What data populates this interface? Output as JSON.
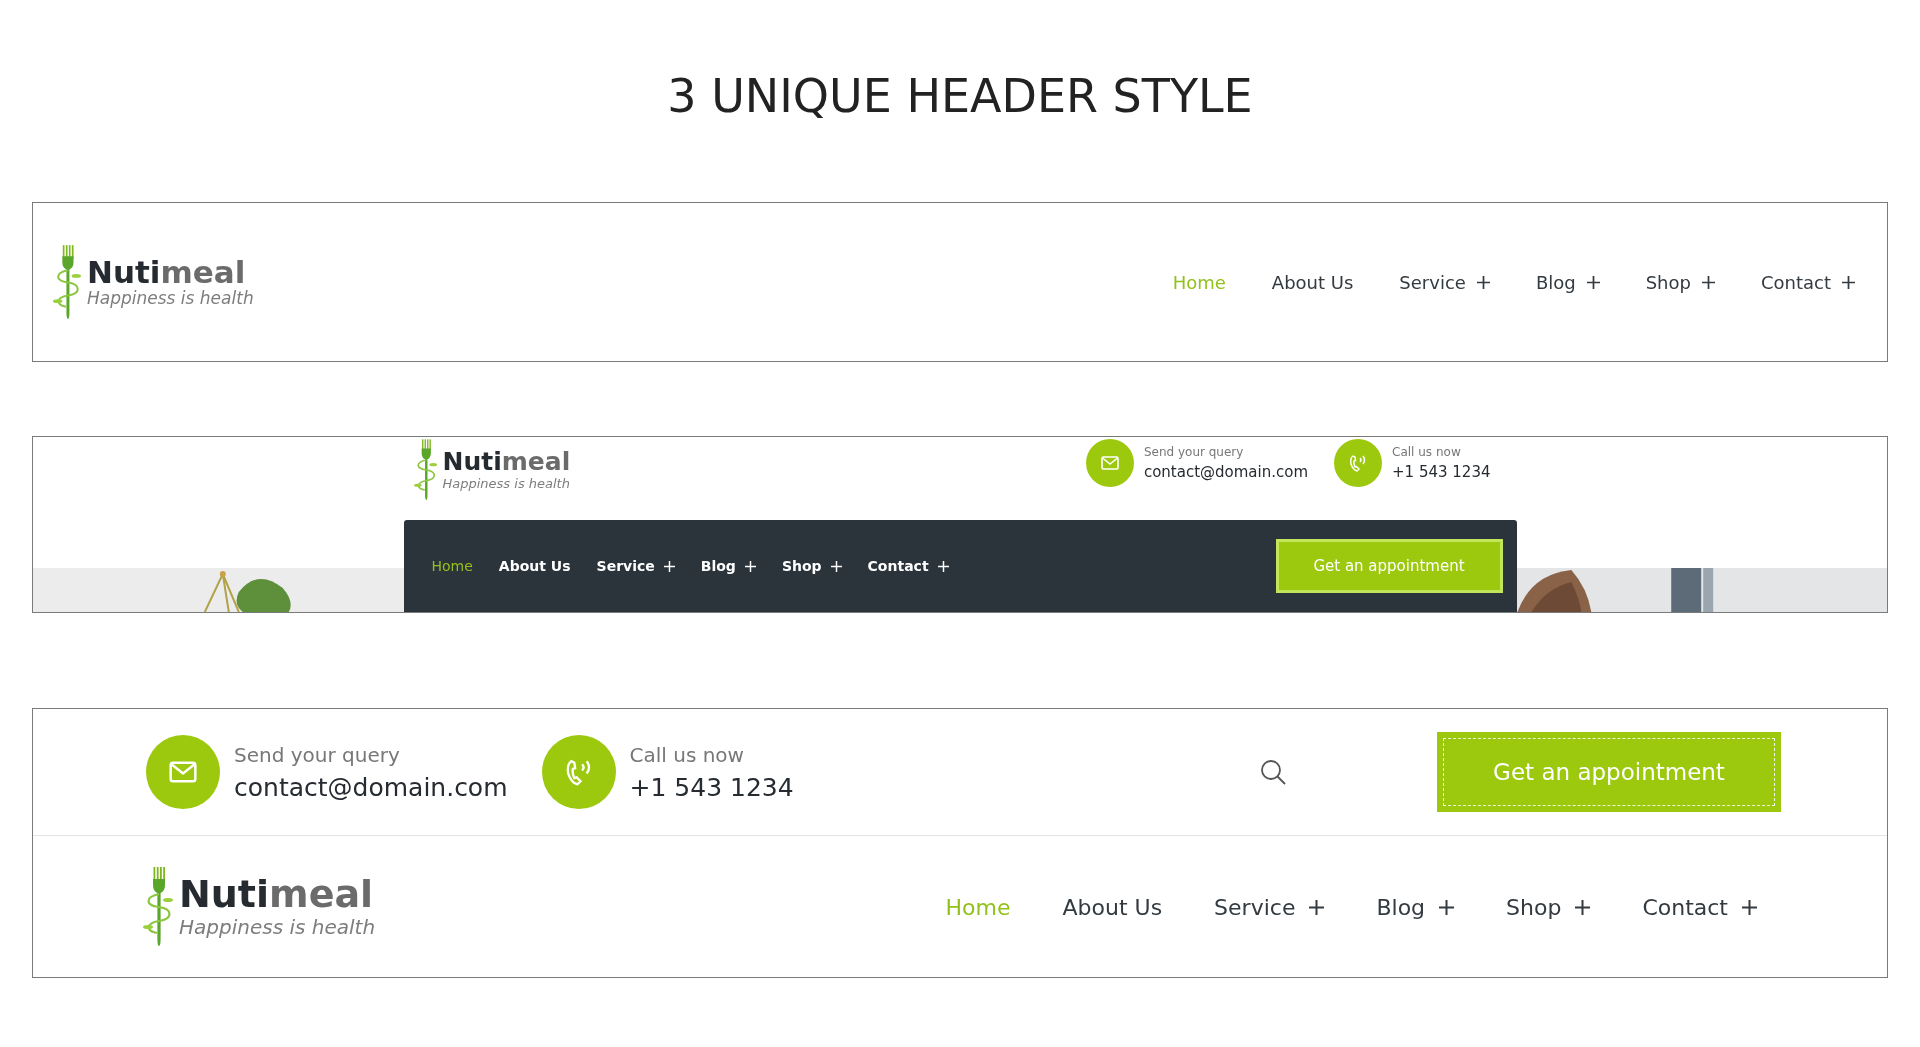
{
  "page_title": "3 UNIQUE HEADER STYLE",
  "headers": [
    {
      "kind": "simple",
      "logo": {
        "name_dark": "Nuti",
        "name_light": "meal",
        "tagline": "Happiness is health"
      },
      "nav": [
        {
          "label": "Home",
          "selected": true,
          "submenu": false
        },
        {
          "label": "About Us",
          "selected": false,
          "submenu": false
        },
        {
          "label": "Service",
          "selected": false,
          "submenu": true
        },
        {
          "label": "Blog",
          "selected": false,
          "submenu": true
        },
        {
          "label": "Shop",
          "selected": false,
          "submenu": true
        },
        {
          "label": "Contact",
          "selected": false,
          "submenu": true
        }
      ]
    },
    {
      "kind": "dark_bar",
      "logo": {
        "name_dark": "Nuti",
        "name_light": "meal",
        "tagline": "Happiness is health"
      },
      "contacts": [
        {
          "kind": "email",
          "label": "Send your query",
          "value": "contact@domain.com"
        },
        {
          "kind": "phone",
          "label": "Call us now",
          "value": "+1 543 1234"
        }
      ],
      "nav": [
        {
          "label": "Home",
          "selected": true,
          "submenu": false
        },
        {
          "label": "About Us",
          "selected": false,
          "submenu": false
        },
        {
          "label": "Service",
          "selected": false,
          "submenu": true
        },
        {
          "label": "Blog",
          "selected": false,
          "submenu": true
        },
        {
          "label": "Shop",
          "selected": false,
          "submenu": true
        },
        {
          "label": "Contact",
          "selected": false,
          "submenu": true
        }
      ],
      "button": "Get an appointment"
    },
    {
      "kind": "two_row",
      "contacts": [
        {
          "kind": "email",
          "label": "Send your query",
          "value": "contact@domain.com"
        },
        {
          "kind": "phone",
          "label": "Call us now",
          "value": "+1 543 1234"
        }
      ],
      "button": "Get an appointment",
      "logo": {
        "name_dark": "Nuti",
        "name_light": "meal",
        "tagline": "Happiness is health"
      },
      "nav": [
        {
          "label": "Home",
          "selected": true,
          "submenu": false
        },
        {
          "label": "About Us",
          "selected": false,
          "submenu": false
        },
        {
          "label": "Service",
          "selected": false,
          "submenu": true
        },
        {
          "label": "Blog",
          "selected": false,
          "submenu": true
        },
        {
          "label": "Shop",
          "selected": false,
          "submenu": true
        },
        {
          "label": "Contact",
          "selected": false,
          "submenu": true
        }
      ]
    }
  ]
}
